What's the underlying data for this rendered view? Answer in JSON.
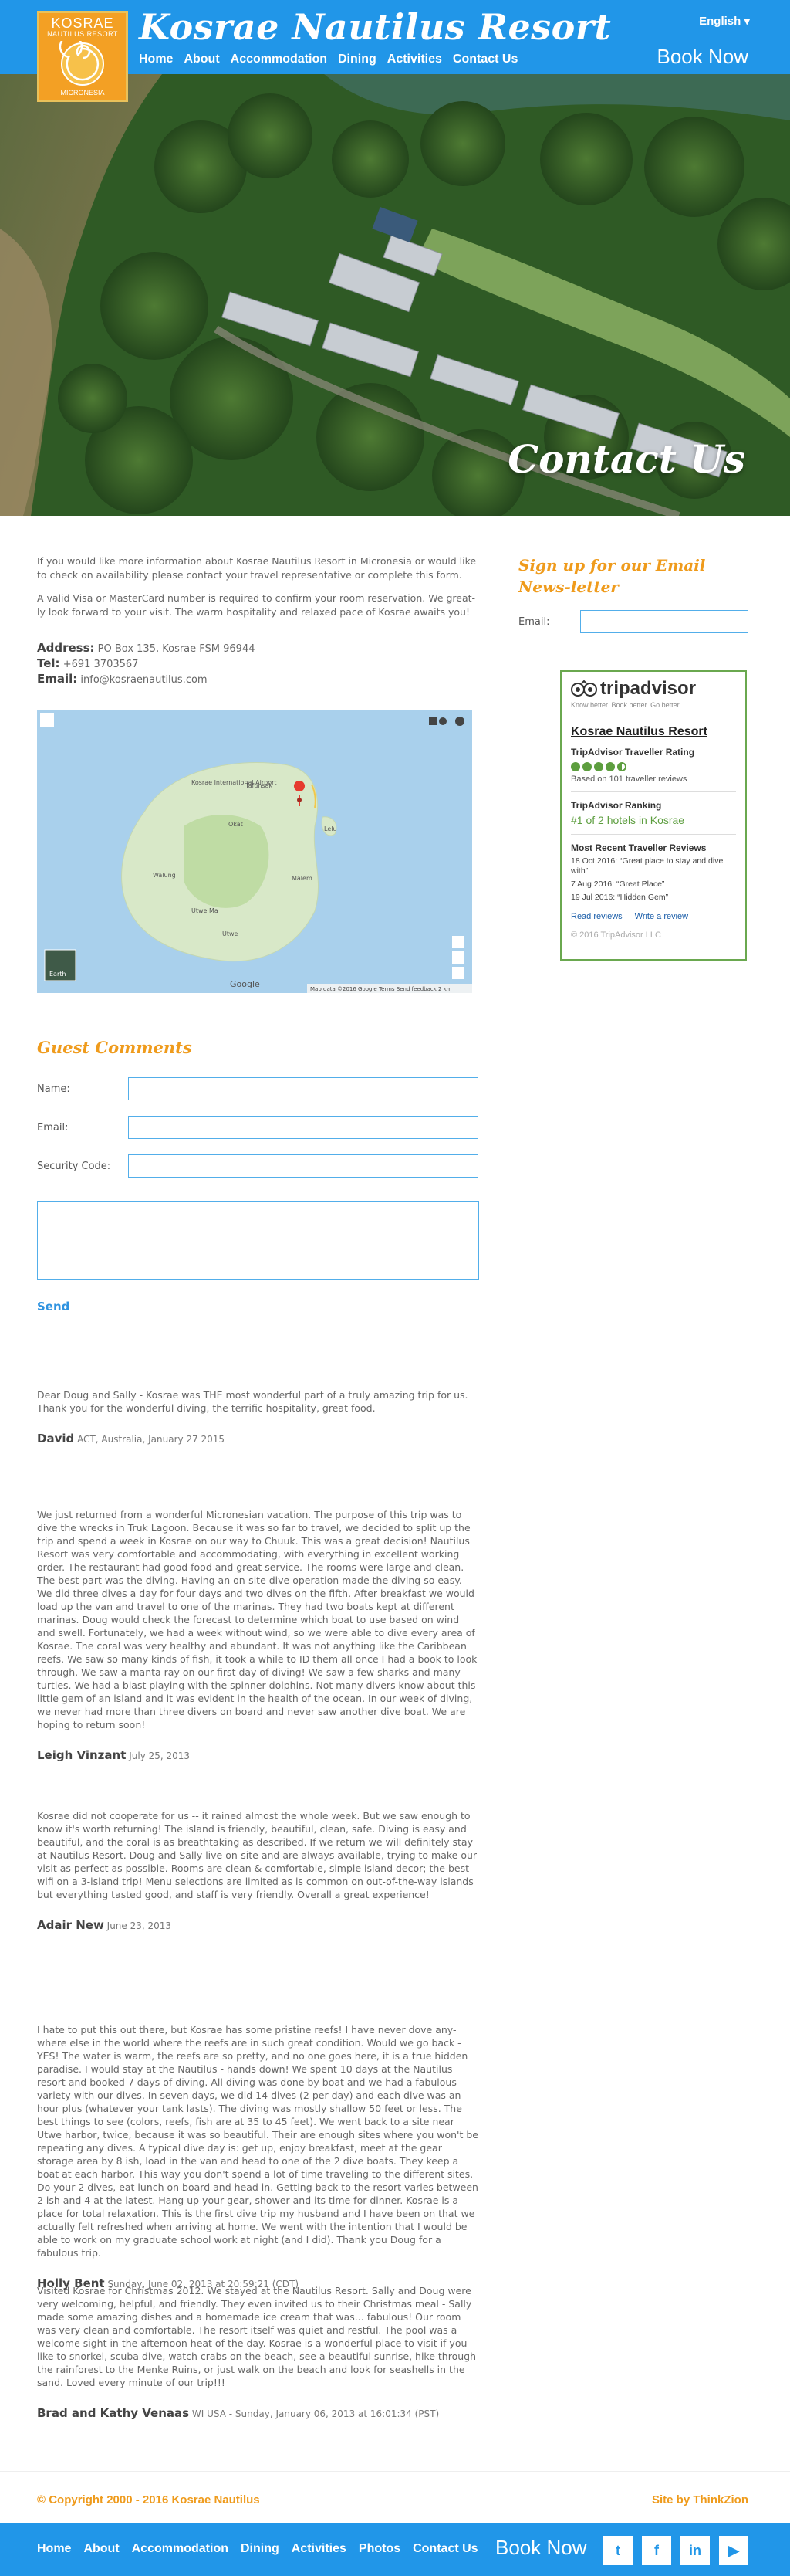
{
  "header": {
    "logo": {
      "top": "KOSRAE",
      "sub": "NAUTILUS RESORT",
      "bottom": "MICRONESIA"
    },
    "site_title": "Kosrae Nautilus Resort",
    "nav": [
      "Home",
      "About",
      "Accommodation",
      "Dining",
      "Activities",
      "Contact Us"
    ],
    "language": "English",
    "language_arrow": "▾",
    "book_now": "Book Now"
  },
  "hero": {
    "title": "Contact Us"
  },
  "intro": {
    "p1": "If you would like more information about Kosrae Nautilus Resort in Micronesia or would like to check on availability please contact your travel representative or complete this form.",
    "p2": "A valid Visa or MasterCard number is required to confirm your room reservation. We great- ly look forward to your visit. The warm hospitality and relaxed pace of Kosrae awaits you!"
  },
  "address": {
    "address_label": "Address:",
    "address_value": "PO Box 135, Kosrae FSM 96944",
    "tel_label": "Tel:",
    "tel_value": "+691 3703567",
    "email_label": "Email:",
    "email_value": "info@kosraenautilus.com"
  },
  "map": {
    "labels": [
      "Kosrae International Airport",
      "Tafunsak",
      "Okat",
      "Walung",
      "Lelu",
      "Malem",
      "Utwe",
      "Utwe Ma"
    ],
    "footer": "Map data ©2016 Google   Terms   Send feedback   2 km",
    "google": "Google",
    "earth": "Earth"
  },
  "guest": {
    "title": "Guest Comments",
    "name_label": "Name:",
    "email_label": "Email:",
    "security_label": "Security Code:",
    "send": "Send"
  },
  "comments": [
    {
      "text": "Dear Doug and Sally - Kosrae was THE most wonderful part of a truly amazing trip for us. Thank you for the wonderful diving, the terrific hospitality, great food.",
      "name": "David",
      "meta": "ACT, Australia, January 27 2015"
    },
    {
      "text": "We just returned from a wonderful Micronesian vacation. The purpose of this trip was to dive the wrecks in Truk Lagoon. Because it was so far to travel, we decided to split up the trip and spend a week in Kosrae on our way to Chuuk. This was a great decision! Nautilus Resort was very comfortable and accommodating, with everything in excellent working order. The restaurant had good food and great service. The rooms were large and clean. The best part was the diving. Having an on-site dive operation made the diving so easy. We did three dives a day for four days and two dives on the fifth. After breakfast we would load up the van and travel to one of the marinas. They had two boats kept at different marinas. Doug would check the forecast to determine which boat to use based on wind and swell. Fortunately, we had a week without wind, so we were able to dive every area of Kosrae. The coral was very healthy and abundant. It was not anything like the Caribbean reefs. We saw so many kinds of fish, it took a while to ID them all once I had a book to look through. We saw a manta ray on our first day of diving! We saw a few sharks and many turtles. We had a blast playing with the spinner dolphins. Not many divers know about this little gem of an island and it was evident in the health of the ocean. In our week of diving, we never had more than three divers on board and never saw another dive boat. We are hoping to return soon!",
      "name": "Leigh Vinzant",
      "meta": "July 25, 2013"
    },
    {
      "text": "Kosrae did not cooperate for us -- it rained almost the whole week. But we saw enough to know it's worth returning! The island is friendly, beautiful, clean, safe. Diving is easy and beautiful, and the coral is as breathtaking as described. If we return we will definitely stay at Nautilus Resort. Doug and Sally live on-site and are always available, trying to make our visit as perfect as possible. Rooms are clean & comfortable, simple island decor; the best wifi on a 3-island trip! Menu selections are limited as is common on out-of-the-way islands but everything tasted good, and staff is very friendly. Overall a great experience!",
      "name": "Adair New",
      "meta": "June 23, 2013"
    },
    {
      "text": "I hate to put this out there, but Kosrae has some pristine reefs! I have never dove any- where else in the world where the reefs are in such great condition. Would we go back - YES! The water is warm, the reefs are so pretty, and no one goes here, it is a true hidden paradise. I would stay at the Nautilus - hands down! We spent 10 days at the Nautilus resort and booked 7 days of diving. All diving was done by boat and we had a fabulous variety with our dives. In seven days, we did 14 dives (2 per day) and each dive was an hour plus (whatever your tank lasts). The diving was mostly shallow 50 feet or less. The best things to see (colors, reefs, fish are at 35 to 45 feet). We went back to a site near Utwe harbor, twice, because it was so beautiful. Their are enough sites where you won't be repeating any dives. A typical dive day is: get up, enjoy breakfast, meet at the gear storage area by 8 ish, load in the van and head to one of the 2 dive boats. They keep a boat at each harbor. This way you don't spend a lot of time traveling to the different sites. Do your 2 dives, eat lunch on board and head in. Getting back to the resort varies between 2 ish and 4 at the latest. Hang up your gear, shower and its time for dinner. Kosrae is a place for total relaxation. This is the first dive trip my husband and I have been on that we actually felt refreshed when arriving at home. We went with the intention that I would be able to work on my graduate school work at night (and I did). Thank you Doug for a fabulous trip.",
      "name": "Holly Bent",
      "meta": "Sunday, June 02, 2013 at 20:59:21 (CDT)"
    },
    {
      "text": "Visited Kosrae for Christmas 2012. We stayed at the Nautilus Resort. Sally and Doug were very welcoming, helpful, and friendly. They even invited us to their Christmas meal - Sally made some amazing dishes and a homemade ice cream that was... fabulous! Our room was very clean and comfortable. The resort itself was quiet and restful. The pool was a welcome sight in the afternoon heat of the day. Kosrae is a wonderful place to visit if you like to snorkel, scuba dive, watch crabs on the beach, see a beautiful sunrise, hike through the rainforest to the Menke Ruins, or just walk on the beach and look for seashells in the sand. Loved every minute of our trip!!!",
      "name": "Brad and Kathy Venaas",
      "meta": "WI USA - Sunday, January 06, 2013 at 16:01:34 (PST)"
    }
  ],
  "newsletter": {
    "title": "Sign up for our Email News-letter",
    "email_label": "Email:"
  },
  "tripadvisor": {
    "logo_text": "tripadvisor",
    "tagline": "Know better. Book better. Go better.",
    "name": "Kosrae Nautilus Resort",
    "rating_heading": "TripAdvisor Traveller Rating",
    "rating_value": 4.5,
    "rating_max": 5,
    "based_on": "Based on 101 traveller reviews",
    "ranking_heading": "TripAdvisor Ranking",
    "ranking": "#1 of 2 hotels in Kosrae",
    "recent_heading": "Most Recent Traveller Reviews",
    "reviews": [
      "18 Oct 2016: “Great place to stay and dive with”",
      "7 Aug 2016: “Great Place”",
      "19 Jul 2016: “Hidden Gem”"
    ],
    "read_reviews": "Read reviews",
    "write_review": "Write a review",
    "copyright": "© 2016 TripAdvisor LLC"
  },
  "footer": {
    "copyright": "© Copyright 2000 - 2016 Kosrae Nautilus",
    "credit": "Site by ThinkZion",
    "nav": [
      "Home",
      "About",
      "Accommodation",
      "Dining",
      "Activities",
      "Photos",
      "Contact Us"
    ],
    "book_now": "Book Now",
    "social": [
      "t",
      "f",
      "in",
      "▶"
    ]
  },
  "colors": {
    "brand_blue": "#2196e8",
    "accent_orange": "#ef9b1c",
    "field_border": "#52aeea",
    "ta_green": "#5d9e3f"
  }
}
